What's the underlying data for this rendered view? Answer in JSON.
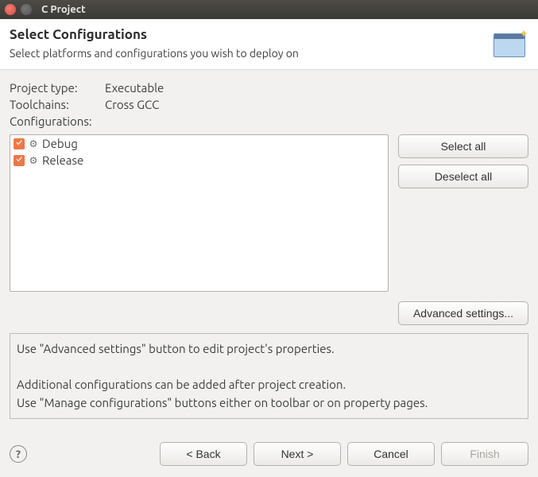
{
  "window": {
    "title": "C Project"
  },
  "header": {
    "title": "Select Configurations",
    "subtitle": "Select platforms and configurations you wish to deploy on"
  },
  "info": {
    "project_type_label": "Project type:",
    "project_type_value": "Executable",
    "toolchains_label": "Toolchains:",
    "toolchains_value": "Cross GCC",
    "configurations_label": "Configurations:"
  },
  "configurations": [
    {
      "label": "Debug",
      "checked": true
    },
    {
      "label": "Release",
      "checked": true
    }
  ],
  "buttons": {
    "select_all": "Select all",
    "deselect_all": "Deselect all",
    "advanced": "Advanced settings..."
  },
  "hints": {
    "line1": "Use \"Advanced settings\" button to edit project's properties.",
    "line2": "Additional configurations can be added after project creation.",
    "line3": "Use \"Manage configurations\" buttons either on toolbar or on property pages."
  },
  "footer": {
    "back": "< Back",
    "next": "Next >",
    "cancel": "Cancel",
    "finish": "Finish"
  }
}
